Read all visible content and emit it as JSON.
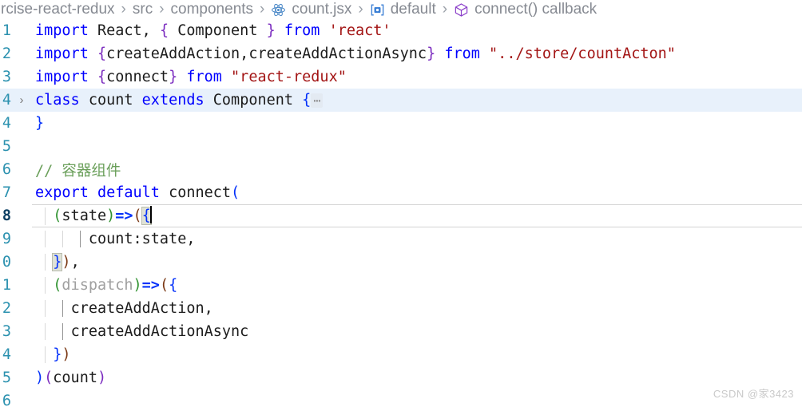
{
  "breadcrumb": {
    "items": [
      {
        "label": "rcise-react-redux",
        "icon": "none"
      },
      {
        "label": "src",
        "icon": "none"
      },
      {
        "label": "components",
        "icon": "none"
      },
      {
        "label": "count.jsx",
        "icon": "react-atom-icon"
      },
      {
        "label": "default",
        "icon": "module-symbol-icon"
      },
      {
        "label": "connect() callback",
        "icon": "cube-symbol-icon"
      }
    ],
    "separator": "›"
  },
  "editor": {
    "fold_arrow": "›",
    "fold_dots": "⋯",
    "lines": [
      {
        "num": "1",
        "state": "normal"
      },
      {
        "num": "2",
        "state": "normal"
      },
      {
        "num": "3",
        "state": "normal"
      },
      {
        "num": "4",
        "state": "folded"
      },
      {
        "num": "4",
        "state": "normal"
      },
      {
        "num": "5",
        "state": "normal"
      },
      {
        "num": "6",
        "state": "normal"
      },
      {
        "num": "7",
        "state": "normal"
      },
      {
        "num": "8",
        "state": "active"
      },
      {
        "num": "9",
        "state": "normal"
      },
      {
        "num": "0",
        "state": "normal"
      },
      {
        "num": "1",
        "state": "normal"
      },
      {
        "num": "2",
        "state": "normal"
      },
      {
        "num": "3",
        "state": "normal"
      },
      {
        "num": "4",
        "state": "normal"
      },
      {
        "num": "5",
        "state": "normal"
      },
      {
        "num": "6",
        "state": "normal"
      }
    ],
    "code": {
      "l1_import": "import",
      "l1_react": " React, ",
      "l1_brace_open": "{",
      "l1_component": " Component ",
      "l1_brace_close": "}",
      "l1_from": " from ",
      "l1_module": "'react'",
      "l2_import": "import",
      "l2_sp": " ",
      "l2_brace_open": "{",
      "l2_names": "createAddAction,createAddActionAsync",
      "l2_brace_close": "}",
      "l2_from": " from ",
      "l2_module": "\"../store/countActon\"",
      "l3_import": "import",
      "l3_sp": " ",
      "l3_brace_open": "{",
      "l3_names": "connect",
      "l3_brace_close": "}",
      "l3_from": " from ",
      "l3_module": "\"react-redux\"",
      "l4_class": "class",
      "l4_name": " count ",
      "l4_extends": "extends",
      "l4_component": " Component ",
      "l4_brace": "{",
      "l5_brace": "}",
      "l6_empty": "",
      "l7_comment": "// 容器组件",
      "l8_export": "export",
      "l8_sp1": " ",
      "l8_default": "default",
      "l8_connect": " connect",
      "l8_paren": "(",
      "l9_indent": "  ",
      "l9_p1": "(",
      "l9_state": "state",
      "l9_p2": ")",
      "l9_arrow": "=>",
      "l9_p3": "(",
      "l9_brace": "{",
      "l10_indent": "      ",
      "l10_text": "count:state,",
      "l11_indent": "  ",
      "l11_brace": "}",
      "l11_paren": ")",
      "l11_comma": ",",
      "l12_indent": "  ",
      "l12_p1": "(",
      "l12_dispatch": "dispatch",
      "l12_p2": ")",
      "l12_arrow": "=>",
      "l12_p3": "(",
      "l12_brace": "{",
      "l13_indent": "    ",
      "l13_text": "createAddAction,",
      "l14_indent": "    ",
      "l14_text": "createAddActionAsync",
      "l15_indent": "  ",
      "l15_brace": "}",
      "l15_paren": ")",
      "l16_p1": ")",
      "l16_p2": "(",
      "l16_count": "count",
      "l16_p3": ")",
      "l17_empty": ""
    }
  },
  "watermark": {
    "text": "CSDN @家3423"
  },
  "colors": {
    "keyword": "#0000ff",
    "string": "#a31515",
    "comment": "#6a9f5a",
    "bracket_blue": "#0431fa",
    "bracket_green": "#319331",
    "bracket_orange": "#7b3814",
    "bracket_purple": "#7b2cbf",
    "line_number": "#2b91af",
    "folded_highlight": "#e8f1fb",
    "breadcrumb_text": "#868a92"
  }
}
